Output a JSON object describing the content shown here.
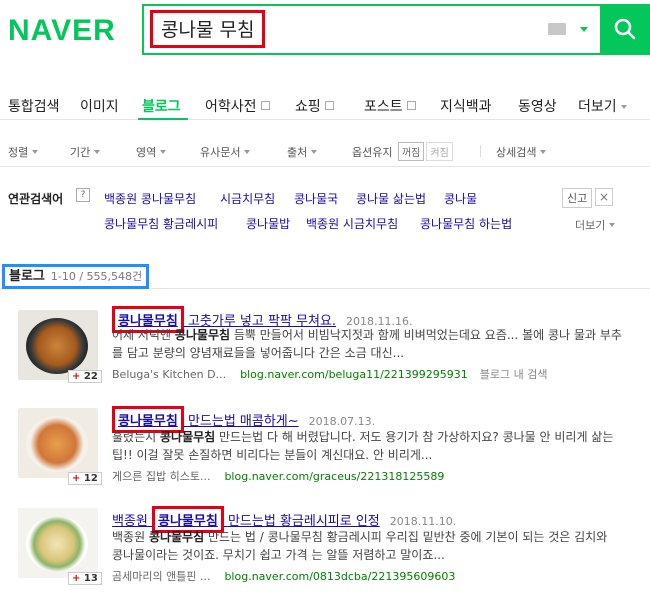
{
  "header": {
    "logo": "NAVER",
    "query": "콩나물 무침"
  },
  "tabs": [
    {
      "label": "통합검색"
    },
    {
      "label": "이미지"
    },
    {
      "label": "블로그"
    },
    {
      "label": "어학사전"
    },
    {
      "label": "쇼핑"
    },
    {
      "label": "포스트"
    },
    {
      "label": "지식백과"
    },
    {
      "label": "동영상"
    },
    {
      "label": "더보기"
    }
  ],
  "options": {
    "sort": "정렬",
    "period": "기간",
    "area": "영역",
    "similar": "유사문서",
    "source": "출처",
    "keep_label": "옵션유지",
    "on": "꺼짐",
    "off": "켜짐",
    "detail": "상세검색"
  },
  "related": {
    "title": "연관검색어",
    "help": "?",
    "report": "신고",
    "close": "×",
    "more": "더보기",
    "terms": [
      "백종원 콩나물무침",
      "시금치무침",
      "콩나물국",
      "콩나물 삶는법",
      "콩나물",
      "콩나물무침 황금레시피",
      "콩나물밥",
      "백종원 시금치무침",
      "콩나물무침 하는법"
    ]
  },
  "section": {
    "title": "블로그",
    "count": "1-10 / 555,548건"
  },
  "results": [
    {
      "hl": "콩나물무침",
      "title_rest": "고춧가루 넣고 팍팍 무쳐요.",
      "date": "2018.11.16.",
      "desc_a": "어제 저녁엔 ",
      "desc_b": "콩나물무침",
      "desc_c": " 듬뿍 만들어서 비빔낙지젓과 함께 비벼먹었는데요 요즘... 볼에 콩나 물과 부추를 담고 분량의 양념재료들을 넣어줍니다 간은 소금 대신...",
      "source": "Beluga's Kitchen D...",
      "url": "blog.naver.com/beluga11/221399295931",
      "extra": "블로그 내 검색",
      "likes": "22"
    },
    {
      "hl": "콩나물무침",
      "title_rest": "만드는법 매콤하게~",
      "date": "2018.07.13.",
      "desc_a": "훌렸는지 ",
      "desc_b": "콩나물무침",
      "desc_c": " 만드는법 다 해 버렸답니다. 저도 용기가 참 가상하지요? 콩나물 안 비리게 삶는 팁!! 이걸 잘못 손질하면 비리다는 분들이 계신대요. 안 비리게...",
      "source": "게으른 집밥 히스토...",
      "url": "blog.naver.com/graceus/221318125589",
      "extra": "",
      "likes": "12"
    },
    {
      "prefix": "백종원 ",
      "hl": "콩나물무침",
      "title_rest": "만드는법 황금레시피로 인정",
      "date": "2018.11.10.",
      "desc_a": "백종원 ",
      "desc_b": "콩나물무침",
      "desc_c": " 만드는 법 / 콩나물무침 황금레시피 우리집 밑반찬 중에 기본이 되는 것은 김치와 콩나물이라는 것이죠. 무치기 쉽고 가격 는 알뜰 저렴하고 말이죠...",
      "source": "곰세마리의 앤틀핀 ...",
      "url": "blog.naver.com/0813dcba/221395609603",
      "extra": "",
      "likes": "13"
    }
  ]
}
